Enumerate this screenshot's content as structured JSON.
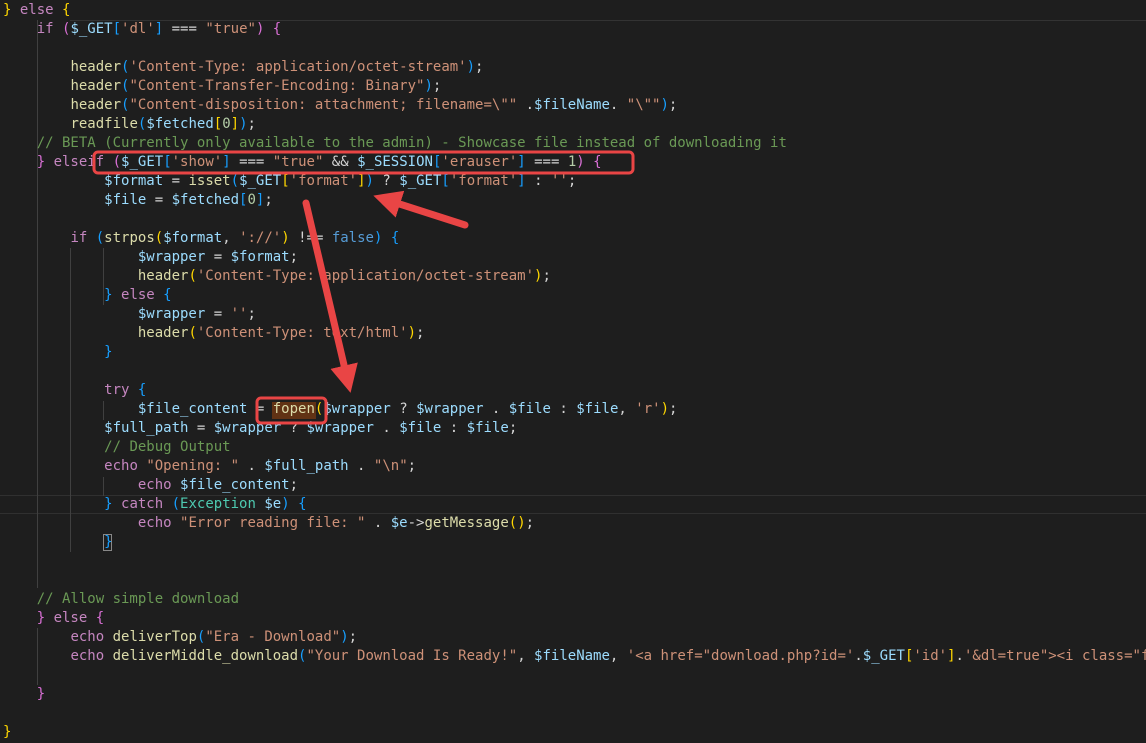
{
  "colors": {
    "background": "#1e1e1e",
    "annotation": "#e94545",
    "keyword_control": "#c586c0",
    "keyword": "#569cd6",
    "variable": "#9cdcfe",
    "string": "#ce9178",
    "function": "#dcdcaa",
    "number": "#b5cea8",
    "comment": "#6a9955",
    "type": "#4ec9b0"
  },
  "code_lines": [
    [
      [
        "} ",
        "k-b1"
      ],
      [
        "else",
        "k-ctrl"
      ],
      [
        " {",
        "k-b1"
      ]
    ],
    [
      [
        "    "
      ],
      [
        "if",
        "k-ctrl"
      ],
      [
        " ",
        "k-plain"
      ],
      [
        "(",
        "k-b2"
      ],
      [
        "$_GET",
        "k-var"
      ],
      [
        "[",
        "k-b3"
      ],
      [
        "'dl'",
        "k-str"
      ],
      [
        "]",
        "k-b3"
      ],
      [
        " === ",
        "k-op"
      ],
      [
        "\"true\"",
        "k-str"
      ],
      [
        ")",
        "k-b2"
      ],
      [
        " {",
        "k-b2"
      ]
    ],
    [
      [
        ""
      ]
    ],
    [
      [
        "        "
      ],
      [
        "header",
        "k-fn"
      ],
      [
        "(",
        "k-b3"
      ],
      [
        "'Content-Type: application/octet-stream'",
        "k-str"
      ],
      [
        ")",
        "k-b3"
      ],
      [
        ";",
        "k-plain"
      ]
    ],
    [
      [
        "        "
      ],
      [
        "header",
        "k-fn"
      ],
      [
        "(",
        "k-b3"
      ],
      [
        "\"Content-Transfer-Encoding: Binary\"",
        "k-str"
      ],
      [
        ")",
        "k-b3"
      ],
      [
        ";",
        "k-plain"
      ]
    ],
    [
      [
        "        "
      ],
      [
        "header",
        "k-fn"
      ],
      [
        "(",
        "k-b3"
      ],
      [
        "\"Content-disposition: attachment; filename=\\\"\" ",
        "k-str"
      ],
      [
        ".",
        "k-op"
      ],
      [
        "$fileName",
        "k-var"
      ],
      [
        ". ",
        "k-op"
      ],
      [
        "\"\\\"\"",
        "k-str"
      ],
      [
        ")",
        "k-b3"
      ],
      [
        ";",
        "k-plain"
      ]
    ],
    [
      [
        "        "
      ],
      [
        "readfile",
        "k-fn"
      ],
      [
        "(",
        "k-b3"
      ],
      [
        "$fetched",
        "k-var"
      ],
      [
        "[",
        "k-b1"
      ],
      [
        "0",
        "k-num"
      ],
      [
        "]",
        "k-b1"
      ],
      [
        ")",
        "k-b3"
      ],
      [
        ";",
        "k-plain"
      ]
    ],
    [
      [
        "    "
      ],
      [
        "// BETA (Currently only available to the admin) - Showcase file instead of downloading it",
        "k-cmt"
      ]
    ],
    [
      [
        "    "
      ],
      [
        "} ",
        "k-b2"
      ],
      [
        "else",
        "k-ctrl"
      ],
      [
        "if",
        "k-ctrl"
      ],
      [
        " ",
        "k-plain"
      ],
      [
        "(",
        "k-b2"
      ],
      [
        "$_GET",
        "k-var"
      ],
      [
        "[",
        "k-b3"
      ],
      [
        "'show'",
        "k-str"
      ],
      [
        "]",
        "k-b3"
      ],
      [
        " === ",
        "k-op"
      ],
      [
        "\"true\"",
        "k-str"
      ],
      [
        " && ",
        "k-op"
      ],
      [
        "$_SESSION",
        "k-var"
      ],
      [
        "[",
        "k-b3"
      ],
      [
        "'erauser'",
        "k-str"
      ],
      [
        "]",
        "k-b3"
      ],
      [
        " === ",
        "k-op"
      ],
      [
        "1",
        "k-num"
      ],
      [
        ")",
        "k-b2"
      ],
      [
        " {",
        "k-b2"
      ]
    ],
    [
      [
        "            "
      ],
      [
        "$format",
        "k-var"
      ],
      [
        " = ",
        "k-op"
      ],
      [
        "isset",
        "k-fn"
      ],
      [
        "(",
        "k-b3"
      ],
      [
        "$_GET",
        "k-var"
      ],
      [
        "[",
        "k-b1"
      ],
      [
        "'format'",
        "k-str"
      ],
      [
        "]",
        "k-b1"
      ],
      [
        ")",
        "k-b3"
      ],
      [
        " ? ",
        "k-op"
      ],
      [
        "$_GET",
        "k-var"
      ],
      [
        "[",
        "k-b3"
      ],
      [
        "'format'",
        "k-str"
      ],
      [
        "]",
        "k-b3"
      ],
      [
        " : ",
        "k-op"
      ],
      [
        "''",
        "k-str"
      ],
      [
        ";",
        "k-plain"
      ]
    ],
    [
      [
        "            "
      ],
      [
        "$file",
        "k-var"
      ],
      [
        " = ",
        "k-op"
      ],
      [
        "$fetched",
        "k-var"
      ],
      [
        "[",
        "k-b3"
      ],
      [
        "0",
        "k-num"
      ],
      [
        "]",
        "k-b3"
      ],
      [
        ";",
        "k-plain"
      ]
    ],
    [
      [
        ""
      ]
    ],
    [
      [
        "        "
      ],
      [
        "if",
        "k-ctrl"
      ],
      [
        " ",
        "k-plain"
      ],
      [
        "(",
        "k-b3"
      ],
      [
        "strpos",
        "k-fn"
      ],
      [
        "(",
        "k-b1"
      ],
      [
        "$format",
        "k-var"
      ],
      [
        ", ",
        "k-plain"
      ],
      [
        "'://'",
        "k-str"
      ],
      [
        ")",
        "k-b1"
      ],
      [
        " !== ",
        "k-op"
      ],
      [
        "false",
        "k-kw"
      ],
      [
        ")",
        "k-b3"
      ],
      [
        " {",
        "k-b3"
      ]
    ],
    [
      [
        "                "
      ],
      [
        "$wrapper",
        "k-var"
      ],
      [
        " = ",
        "k-op"
      ],
      [
        "$format",
        "k-var"
      ],
      [
        ";",
        "k-plain"
      ]
    ],
    [
      [
        "                "
      ],
      [
        "header",
        "k-fn"
      ],
      [
        "(",
        "k-b1"
      ],
      [
        "'Content-Type: application/octet-stream'",
        "k-str"
      ],
      [
        ")",
        "k-b1"
      ],
      [
        ";",
        "k-plain"
      ]
    ],
    [
      [
        "            "
      ],
      [
        "} ",
        "k-b3"
      ],
      [
        "else",
        "k-ctrl"
      ],
      [
        " {",
        "k-b3"
      ]
    ],
    [
      [
        "                "
      ],
      [
        "$wrapper",
        "k-var"
      ],
      [
        " = ",
        "k-op"
      ],
      [
        "''",
        "k-str"
      ],
      [
        ";",
        "k-plain"
      ]
    ],
    [
      [
        "                "
      ],
      [
        "header",
        "k-fn"
      ],
      [
        "(",
        "k-b1"
      ],
      [
        "'Content-Type: text/html'",
        "k-str"
      ],
      [
        ")",
        "k-b1"
      ],
      [
        ";",
        "k-plain"
      ]
    ],
    [
      [
        "            "
      ],
      [
        "}",
        "k-b3"
      ]
    ],
    [
      [
        ""
      ]
    ],
    [
      [
        "            "
      ],
      [
        "try",
        "k-ctrl"
      ],
      [
        " {",
        "k-b3"
      ]
    ],
    [
      [
        "                "
      ],
      [
        "$file_content",
        "k-var"
      ],
      [
        " = ",
        "k-op"
      ],
      [
        "fopen",
        "k-fn"
      ],
      [
        "(",
        "k-b1"
      ],
      [
        "$wrapper",
        "k-var"
      ],
      [
        " ? ",
        "k-op"
      ],
      [
        "$wrapper",
        "k-var"
      ],
      [
        " . ",
        "k-op"
      ],
      [
        "$file",
        "k-var"
      ],
      [
        " : ",
        "k-op"
      ],
      [
        "$file",
        "k-var"
      ],
      [
        ", ",
        "k-plain"
      ],
      [
        "'r'",
        "k-str"
      ],
      [
        ")",
        "k-b1"
      ],
      [
        ";",
        "k-plain"
      ]
    ],
    [
      [
        "            "
      ],
      [
        "$full_path",
        "k-var"
      ],
      [
        " = ",
        "k-op"
      ],
      [
        "$wrapper",
        "k-var"
      ],
      [
        " ? ",
        "k-op"
      ],
      [
        "$wrapper",
        "k-var"
      ],
      [
        " . ",
        "k-op"
      ],
      [
        "$file",
        "k-var"
      ],
      [
        " : ",
        "k-op"
      ],
      [
        "$file",
        "k-var"
      ],
      [
        ";",
        "k-plain"
      ]
    ],
    [
      [
        "            "
      ],
      [
        "// Debug Output",
        "k-cmt"
      ]
    ],
    [
      [
        "            "
      ],
      [
        "echo",
        "k-ctrl"
      ],
      [
        " ",
        "k-plain"
      ],
      [
        "\"Opening: \"",
        "k-str"
      ],
      [
        " . ",
        "k-op"
      ],
      [
        "$full_path",
        "k-var"
      ],
      [
        " . ",
        "k-op"
      ],
      [
        "\"\\n\"",
        "k-str"
      ],
      [
        ";",
        "k-plain"
      ]
    ],
    [
      [
        "                "
      ],
      [
        "echo",
        "k-ctrl"
      ],
      [
        " ",
        "k-plain"
      ],
      [
        "$file_content",
        "k-var"
      ],
      [
        ";",
        "k-plain"
      ]
    ],
    [
      [
        "            "
      ],
      [
        "} ",
        "k-b3"
      ],
      [
        "catch",
        "k-ctrl"
      ],
      [
        " ",
        "k-plain"
      ],
      [
        "(",
        "k-b3"
      ],
      [
        "Exception",
        "k-type"
      ],
      [
        " ",
        "k-plain"
      ],
      [
        "$e",
        "k-var"
      ],
      [
        ")",
        "k-b3"
      ],
      [
        " ",
        "k-plain"
      ],
      [
        "{",
        "k-b3"
      ]
    ],
    [
      [
        "                "
      ],
      [
        "echo",
        "k-ctrl"
      ],
      [
        " ",
        "k-plain"
      ],
      [
        "\"Error reading file: \"",
        "k-str"
      ],
      [
        " . ",
        "k-op"
      ],
      [
        "$e",
        "k-var"
      ],
      [
        "->",
        "k-op"
      ],
      [
        "getMessage",
        "k-fn"
      ],
      [
        "(",
        "k-b1"
      ],
      [
        ")",
        "k-b1"
      ],
      [
        ";",
        "k-plain"
      ]
    ],
    [
      [
        "            "
      ],
      [
        "}",
        "k-b3"
      ]
    ],
    [
      [
        ""
      ]
    ],
    [
      [
        ""
      ]
    ],
    [
      [
        "    "
      ],
      [
        "// Allow simple download",
        "k-cmt"
      ]
    ],
    [
      [
        "    "
      ],
      [
        "} ",
        "k-b2"
      ],
      [
        "else",
        "k-ctrl"
      ],
      [
        " {",
        "k-b2"
      ]
    ],
    [
      [
        "        "
      ],
      [
        "echo",
        "k-ctrl"
      ],
      [
        " ",
        "k-plain"
      ],
      [
        "deliverTop",
        "k-fn"
      ],
      [
        "(",
        "k-b3"
      ],
      [
        "\"Era - Download\"",
        "k-str"
      ],
      [
        ")",
        "k-b3"
      ],
      [
        ";",
        "k-plain"
      ]
    ],
    [
      [
        "        "
      ],
      [
        "echo",
        "k-ctrl"
      ],
      [
        " ",
        "k-plain"
      ],
      [
        "deliverMiddle_download",
        "k-fn"
      ],
      [
        "(",
        "k-b3"
      ],
      [
        "\"Your Download Is Ready!\"",
        "k-str"
      ],
      [
        ", ",
        "k-plain"
      ],
      [
        "$fileName",
        "k-var"
      ],
      [
        ", ",
        "k-plain"
      ],
      [
        "'<a href=\"download.php?id='",
        "k-str"
      ],
      [
        ".",
        "k-op"
      ],
      [
        "$_GET",
        "k-var"
      ],
      [
        "[",
        "k-b1"
      ],
      [
        "'id'",
        "k-str"
      ],
      [
        "]",
        "k-b1"
      ],
      [
        ".",
        "k-op"
      ],
      [
        "'&dl=true\"><i class=\"fa",
        "k-str"
      ]
    ],
    [
      [
        ""
      ]
    ],
    [
      [
        "    "
      ],
      [
        "}",
        "k-b2"
      ]
    ],
    [
      [
        ""
      ]
    ],
    [
      [
        "}",
        "k-b1"
      ]
    ]
  ]
}
